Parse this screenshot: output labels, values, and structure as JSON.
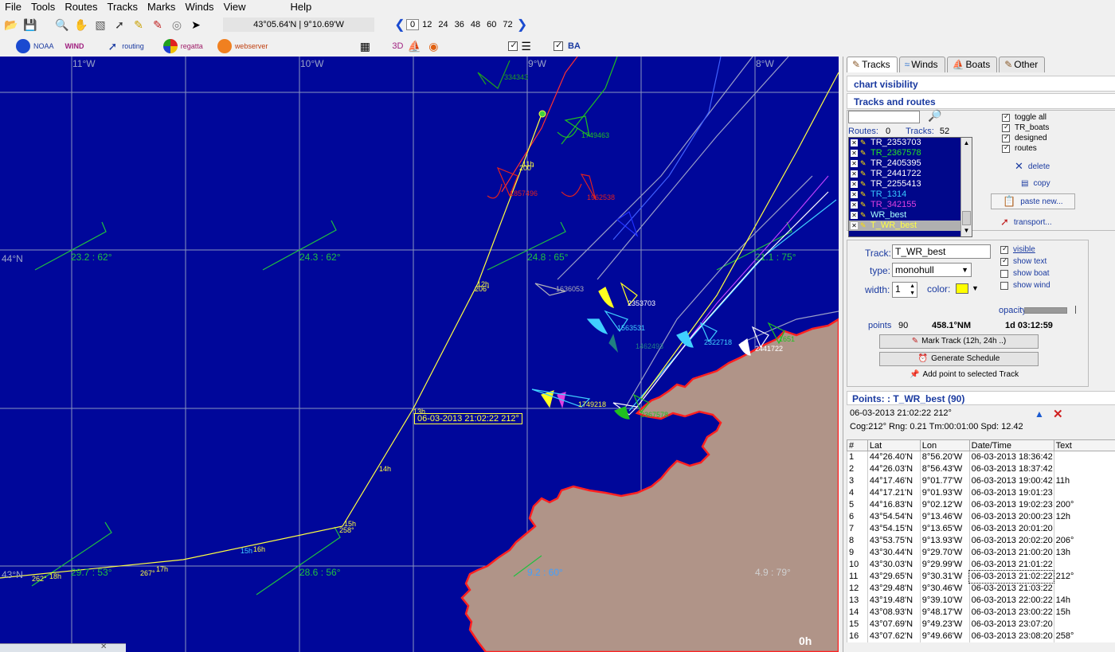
{
  "menu": [
    "File",
    "Tools",
    "Routes",
    "Tracks",
    "Marks",
    "Winds",
    "View",
    "Help"
  ],
  "coord_readout": "43°05.64'N | 9°10.69'W",
  "time_steps": [
    "0",
    "12",
    "24",
    "36",
    "48",
    "60",
    "72"
  ],
  "active_time_step": "0",
  "plugins": {
    "noaa": "NOAA",
    "wind": "WIND",
    "routing": "routing",
    "regatta": "regatta",
    "webserver": "webserver",
    "threed": "3D",
    "ba": "BA"
  },
  "chart": {
    "lon_labels": [
      "11°W",
      "10°W",
      "9°W",
      "8°W"
    ],
    "lat_labels": [
      "44°N",
      "43°N"
    ],
    "wind_labels": [
      "23.2 : 62°",
      "24.3 : 62°",
      "24.8 : 65°",
      "21.1 : 75°",
      "29.7 : 53°",
      "28.6 : 56°",
      "9.2 : 60°",
      "4.9 : 79°"
    ],
    "boat_labels": [
      "334343",
      "1749463",
      "1857496",
      "1962538",
      "1636053",
      "2353703",
      "1563531",
      "1462493",
      "2322718",
      "2441722",
      "1651",
      "1749218",
      "2367578"
    ],
    "track_marks": [
      "11h",
      "200°",
      "12h",
      "206°",
      "13h",
      "14h",
      "15h",
      "258°",
      "16h",
      "17h",
      "267°",
      "18h",
      "262°",
      "15h"
    ],
    "tooltip": "06-03-2013 21:02:22 212°",
    "time_indicator": "0h",
    "colors": {
      "sea": "#00079a",
      "land": "#b09488",
      "coast": "#ff2020",
      "grid": "#9aa4c8"
    }
  },
  "panel": {
    "tabs": [
      "Tracks",
      "Winds",
      "Boats",
      "Other"
    ],
    "active_tab": "Tracks",
    "chart_visibility": "chart visibility",
    "tracks_and_routes": "Tracks and routes",
    "routes_label": "Routes:",
    "routes_count": "0",
    "tracks_label": "Tracks:",
    "tracks_count": "52",
    "track_list": [
      {
        "name": "TR_2353703",
        "color": "#ffffff"
      },
      {
        "name": "TR_2367578",
        "color": "#28e028"
      },
      {
        "name": "TR_2405395",
        "color": "#ffffff"
      },
      {
        "name": "TR_2441722",
        "color": "#ffffff"
      },
      {
        "name": "TR_2255413",
        "color": "#ffffff"
      },
      {
        "name": "TR_1314",
        "color": "#38c8ff"
      },
      {
        "name": "TR_342155",
        "color": "#e040e0"
      },
      {
        "name": "WR_best",
        "color": "#a8ffff"
      },
      {
        "name": "T_WR_best",
        "color": "#ffff40"
      }
    ],
    "visibility_options": [
      {
        "label": "toggle all",
        "checked": true
      },
      {
        "label": "TR_boats",
        "checked": true
      },
      {
        "label": "designed",
        "checked": true
      },
      {
        "label": "routes",
        "checked": true
      }
    ],
    "actions": {
      "delete": "delete",
      "copy": "copy",
      "paste": "paste new...",
      "transport": "transport..."
    },
    "track_label": "Track:",
    "track_value": "T_WR_best",
    "type_label": "type:",
    "type_value": "monohull",
    "width_label": "width:",
    "width_value": "1",
    "color_label": "color:",
    "track_color": "#ffff00",
    "display_options": [
      {
        "label": "visible",
        "checked": true
      },
      {
        "label": "show text",
        "checked": true
      },
      {
        "label": "show boat",
        "checked": false
      },
      {
        "label": "show wind",
        "checked": false
      }
    ],
    "opacity_label": "opacity",
    "points_label": "points",
    "points_value": "90",
    "distance": "458.1°NM",
    "duration": "1d 03:12:59",
    "mark_track_btn": "Mark Track (12h, 24h ..)",
    "generate_schedule_btn": "Generate Schedule",
    "add_point_btn": "Add point to selected Track"
  },
  "points": {
    "title": "Points: : T_WR_best (90)",
    "info1": "06-03-2013 21:02:22 212°",
    "info2": "Cog:212° Rng: 0.21 Tm:00:01:00 Spd: 12.42",
    "columns": [
      "#",
      "Lat",
      "Lon",
      "Date/Time",
      "Text"
    ],
    "rows": [
      [
        "1",
        "44°26.40'N",
        "8°56.20'W",
        "06-03-2013 18:36:42",
        ""
      ],
      [
        "2",
        "44°26.03'N",
        "8°56.43'W",
        "06-03-2013 18:37:42",
        ""
      ],
      [
        "3",
        "44°17.46'N",
        "9°01.77'W",
        "06-03-2013 19:00:42",
        "11h"
      ],
      [
        "4",
        "44°17.21'N",
        "9°01.93'W",
        "06-03-2013 19:01:23",
        ""
      ],
      [
        "5",
        "44°16.83'N",
        "9°02.12'W",
        "06-03-2013 19:02:23",
        "200°"
      ],
      [
        "6",
        "43°54.54'N",
        "9°13.46'W",
        "06-03-2013 20:00:23",
        "12h"
      ],
      [
        "7",
        "43°54.15'N",
        "9°13.65'W",
        "06-03-2013 20:01:20",
        ""
      ],
      [
        "8",
        "43°53.75'N",
        "9°13.93'W",
        "06-03-2013 20:02:20",
        "206°"
      ],
      [
        "9",
        "43°30.44'N",
        "9°29.70'W",
        "06-03-2013 21:00:20",
        "13h"
      ],
      [
        "10",
        "43°30.03'N",
        "9°29.99'W",
        "06-03-2013 21:01:22",
        ""
      ],
      [
        "11",
        "43°29.65'N",
        "9°30.31'W",
        "06-03-2013 21:02:22",
        "212°"
      ],
      [
        "12",
        "43°29.48'N",
        "9°30.46'W",
        "06-03-2013 21:03:22",
        ""
      ],
      [
        "13",
        "43°19.48'N",
        "9°39.10'W",
        "06-03-2013 22:00:22",
        "14h"
      ],
      [
        "14",
        "43°08.93'N",
        "9°48.17'W",
        "06-03-2013 23:00:22",
        "15h"
      ],
      [
        "15",
        "43°07.69'N",
        "9°49.23'W",
        "06-03-2013 23:07:20",
        ""
      ],
      [
        "16",
        "43°07.62'N",
        "9°49.66'W",
        "06-03-2013 23:08:20",
        "258°"
      ]
    ],
    "selected_row": "11"
  }
}
